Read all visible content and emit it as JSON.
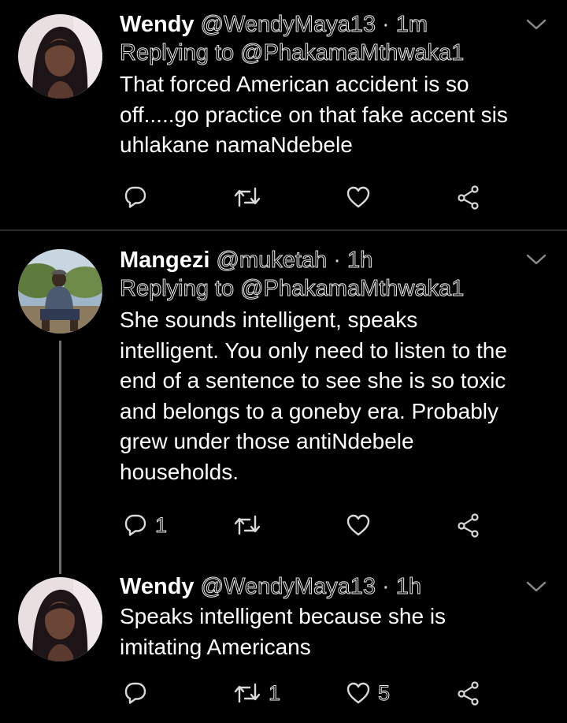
{
  "tweets": [
    {
      "name": "Wendy",
      "handle": "@WendyMaya13",
      "separator": "·",
      "time": "1m",
      "replying_to": "Replying to @PhakamaMthwaka1",
      "lines": [
        "That forced American accident is so",
        "off.....go practice on that fake accent sis",
        "uhlakane namaNdebele"
      ],
      "reply_count": "",
      "retweet_count": "",
      "like_count": ""
    },
    {
      "name": "Mangezi",
      "handle": "@muketah",
      "separator": "·",
      "time": "1h",
      "replying_to": "Replying to @PhakamaMthwaka1",
      "lines": [
        "She sounds intelligent, speaks",
        "intelligent. You only need to listen to the",
        "end of a sentence to see she is so toxic",
        "and belongs to a goneby era. Probably",
        "grew under those antiNdebele",
        "households."
      ],
      "reply_count": "1",
      "retweet_count": "",
      "like_count": ""
    },
    {
      "name": "Wendy",
      "handle": "@WendyMaya13",
      "separator": "·",
      "time": "1h",
      "lines": [
        "Speaks intelligent because she is",
        "imitating Americans"
      ],
      "reply_count": "",
      "retweet_count": "1",
      "like_count": "5"
    }
  ],
  "icons": {
    "reply": "reply-icon",
    "retweet": "retweet-icon",
    "like": "heart-icon",
    "share": "share-icon",
    "menu": "chevron-down-icon"
  },
  "colors": {
    "background": "#000000",
    "text": "#ffffff",
    "icon": "#d9d9d9",
    "divider": "#2a2a2a"
  }
}
